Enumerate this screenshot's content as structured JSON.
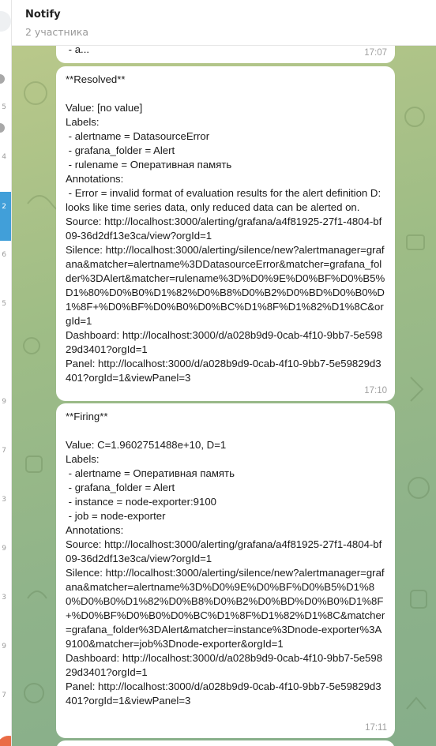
{
  "header": {
    "title": "Notify",
    "subtitle": "2 участника"
  },
  "left_list": {
    "fragments": [
      "5",
      "4",
      "2",
      "6",
      "5",
      "9",
      "7",
      "3",
      "9",
      "3",
      "9",
      "7"
    ]
  },
  "messages": [
    {
      "lines": [
        " - a..."
      ],
      "time": "17:07"
    },
    {
      "lines": [
        "**Resolved**",
        "",
        "Value: [no value]",
        "Labels:",
        " - alertname = DatasourceError",
        " - grafana_folder = Alert",
        " - rulename = Оперативная память",
        "Annotations:",
        " - Error = invalid format of evaluation results for the alert definition D: looks like time series data, only reduced data can be alerted on.",
        "Source: http://localhost:3000/alerting/grafana/a4f81925-27f1-4804-bf09-36d2df13e3ca/view?orgId=1",
        "Silence: http://localhost:3000/alerting/silence/new?alertmanager=grafana&matcher=alertname%3DDatasourceError&matcher=grafana_folder%3DAlert&matcher=rulename%3D%D0%9E%D0%BF%D0%B5%D1%80%D0%B0%D1%82%D0%B8%D0%B2%D0%BD%D0%B0%D1%8F+%D0%BF%D0%B0%D0%BC%D1%8F%D1%82%D1%8C&orgId=1",
        "Dashboard: http://localhost:3000/d/a028b9d9-0cab-4f10-9bb7-5e59829d3401?orgId=1",
        "Panel: http://localhost:3000/d/a028b9d9-0cab-4f10-9bb7-5e59829d3401?orgId=1&viewPanel=3"
      ],
      "time": "17:10"
    },
    {
      "lines": [
        "**Firing**",
        "",
        "Value: C=1.9602751488e+10, D=1",
        "Labels:",
        " - alertname = Оперативная память",
        " - grafana_folder = Alert",
        " - instance = node-exporter:9100",
        " - job = node-exporter",
        "Annotations:",
        "Source: http://localhost:3000/alerting/grafana/a4f81925-27f1-4804-bf09-36d2df13e3ca/view?orgId=1",
        "Silence: http://localhost:3000/alerting/silence/new?alertmanager=grafana&matcher=alertname%3D%D0%9E%D0%BF%D0%B5%D1%80%D0%B0%D1%82%D0%B8%D0%B2%D0%BD%D0%B0%D1%8F+%D0%BF%D0%B0%D0%BC%D1%8F%D1%82%D1%8C&matcher=grafana_folder%3DAlert&matcher=instance%3Dnode-exporter%3A9100&matcher=job%3Dnode-exporter&orgId=1",
        "Dashboard: http://localhost:3000/d/a028b9d9-0cab-4f10-9bb7-5e59829d3401?orgId=1",
        "Panel: http://localhost:3000/d/a028b9d9-0cab-4f10-9bb7-5e59829d3401?orgId=1&viewPanel=3"
      ],
      "time": "17:11"
    }
  ],
  "colors": {
    "accent": "#419fd9",
    "chat_background": "#9fbd86",
    "bubble": "#ffffff",
    "time": "#a0a0a0"
  }
}
